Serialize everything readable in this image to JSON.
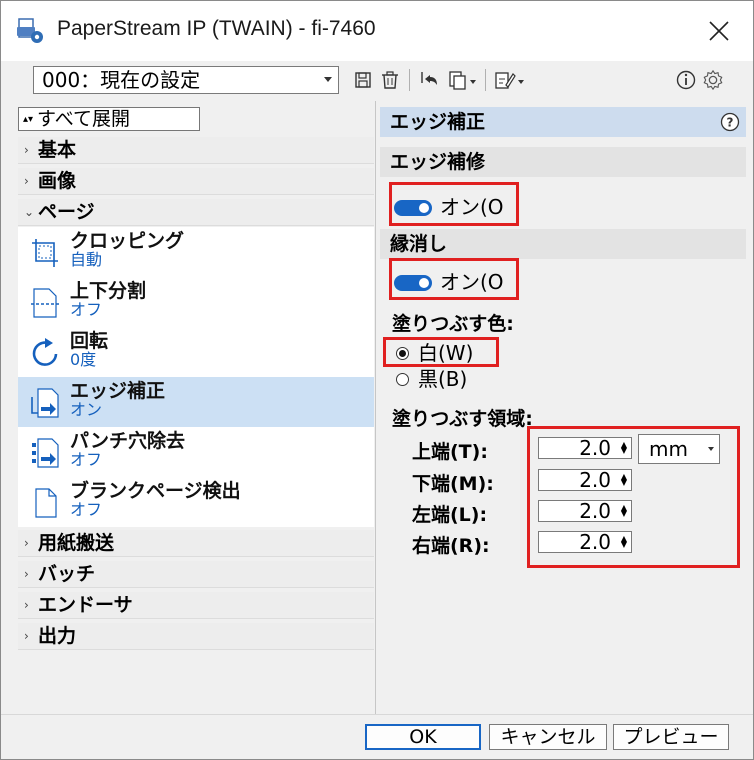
{
  "window": {
    "title": "PaperStream IP (TWAIN) - fi-7460"
  },
  "toolbar": {
    "profile_value": "000：現在の設定",
    "icons": [
      "save-icon",
      "delete-icon",
      "undo-icon",
      "copy-icon",
      "edit-icon",
      "info-icon",
      "settings-gear-icon"
    ]
  },
  "sidebar": {
    "expand_all_label": "すべて展開",
    "categories": {
      "basic": "基本",
      "image": "画像",
      "page": "ページ",
      "paper_feed": "用紙搬送",
      "batch": "バッチ",
      "endorser": "エンドーサ",
      "output": "出力"
    },
    "items": [
      {
        "name": "クロッピング",
        "value": "自動"
      },
      {
        "name": "上下分割",
        "value": "オフ"
      },
      {
        "name": "回転",
        "value": "0度"
      },
      {
        "name": "エッジ補正",
        "value": "オン"
      },
      {
        "name": "パンチ穴除去",
        "value": "オフ"
      },
      {
        "name": "ブランクページ検出",
        "value": "オフ"
      }
    ]
  },
  "panel": {
    "title": "エッジ補正",
    "edge_repair": {
      "heading": "エッジ補修",
      "toggle_label": "オン(O"
    },
    "border_removal": {
      "heading": "縁消し",
      "toggle_label": "オン(O"
    },
    "fill_color": {
      "label": "塗りつぶす色:",
      "white": "白(W)",
      "black": "黒(B)",
      "selected": "white"
    },
    "fill_area": {
      "label": "塗りつぶす領域:",
      "top_label": "上端(T):",
      "bottom_label": "下端(M):",
      "left_label": "左端(L):",
      "right_label": "右端(R):",
      "top_value": "2.0",
      "bottom_value": "2.0",
      "left_value": "2.0",
      "right_value": "2.0",
      "unit": "mm"
    }
  },
  "buttons": {
    "ok": "OK",
    "cancel": "キャンセル",
    "preview": "プレビュー"
  },
  "colors": {
    "accent": "#1866c5",
    "selected_row": "#cce0f4",
    "panel_header": "#cddcee",
    "highlight_box": "#e02020"
  }
}
